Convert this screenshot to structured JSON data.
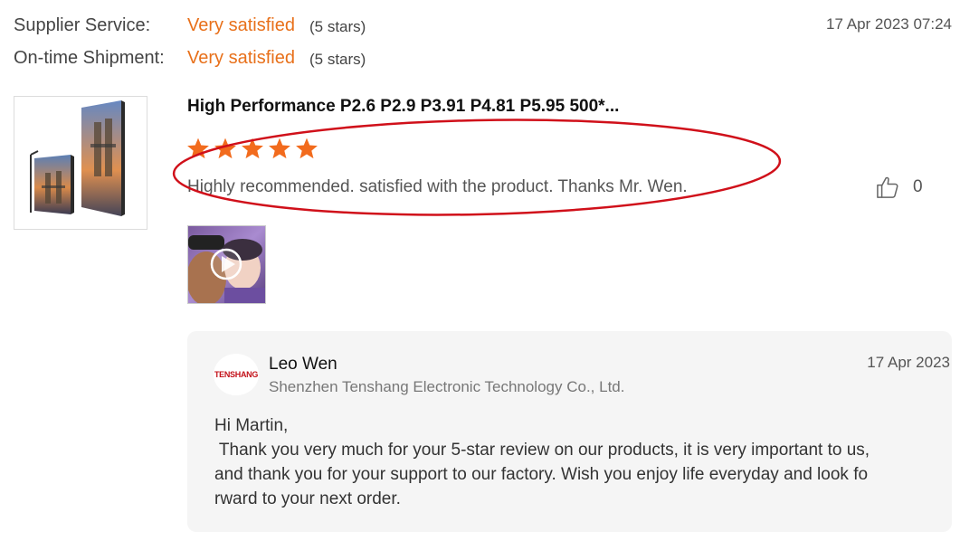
{
  "ratings": {
    "supplier_service": {
      "label": "Supplier Service:",
      "value": "Very satisfied",
      "count": "(5 stars)"
    },
    "ontime_shipment": {
      "label": "On-time Shipment:",
      "value": "Very satisfied",
      "count": "(5 stars)"
    }
  },
  "review": {
    "date": "17 Apr 2023 07:24",
    "product_title": "High Performance P2.6 P2.9 P3.91 P4.81 P5.95 500*...",
    "star_rating": 5,
    "text": "Highly recommended. satisfied with the product. Thanks Mr. Wen.",
    "likes": "0"
  },
  "reply": {
    "logo_text": "TENSHANG",
    "name": "Leo Wen",
    "company": "Shenzhen Tenshang Electronic Technology Co., Ltd.",
    "date": "17 Apr 2023",
    "body": "Hi Martin,\n Thank you very much for your 5-star review on our products, it is very important to us,\nand thank you for your support to our factory. Wish you enjoy life everyday and look fo\nrward to your next order."
  },
  "colors": {
    "accent": "#e8701a",
    "star": "#f26b1d",
    "annotation": "#d0101a",
    "reply_bg": "#f5f5f5"
  },
  "icons": {
    "like": "thumbs-up-icon",
    "play": "play-icon",
    "star": "star-icon"
  }
}
